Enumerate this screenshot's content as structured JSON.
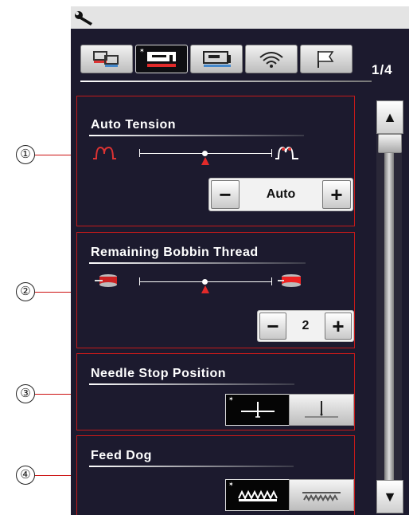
{
  "callouts": [
    "①",
    "②",
    "③",
    "④"
  ],
  "header": {
    "page_indicator": "1/4"
  },
  "tabs": [
    {
      "icon": "machine-settings-icon",
      "active": false
    },
    {
      "icon": "sewing-settings-icon",
      "active": true
    },
    {
      "icon": "embroidery-settings-icon",
      "active": false
    },
    {
      "icon": "wireless-icon",
      "active": false
    },
    {
      "icon": "language-flag-icon",
      "active": false
    }
  ],
  "sections": {
    "auto_tension": {
      "title": "Auto Tension",
      "stepper": {
        "minus": "−",
        "value": "Auto",
        "plus": "+"
      },
      "slider_level": 0.5
    },
    "bobbin": {
      "title": "Remaining Bobbin Thread",
      "stepper": {
        "minus": "−",
        "value": "2",
        "plus": "+"
      },
      "slider_level": 0.5
    },
    "needle_stop": {
      "title": "Needle Stop Position",
      "selected": "up"
    },
    "feed_dog": {
      "title": "Feed Dog",
      "selected": "up"
    }
  },
  "scrollbar": {
    "up": "▲",
    "down": "▼"
  },
  "colors": {
    "screen_bg": "#1c1a2e",
    "section_border": "#c41a1a",
    "accent_red": "#e22a2a"
  }
}
